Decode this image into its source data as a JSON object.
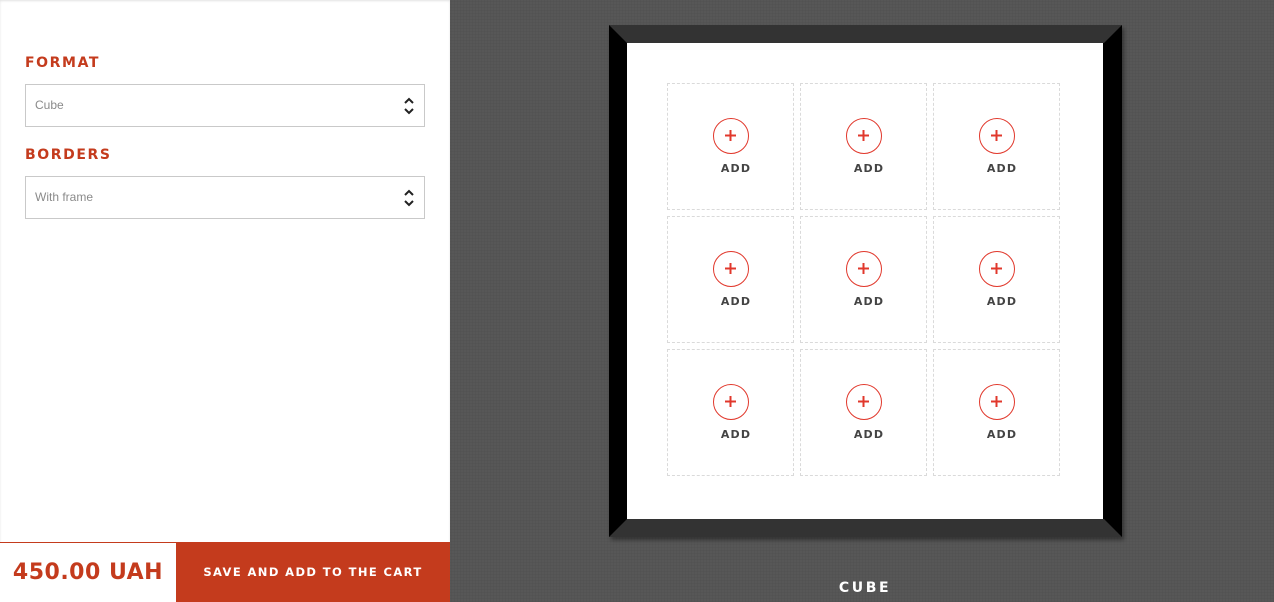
{
  "sidebar": {
    "format": {
      "label": "FORMAT",
      "selected": "Cube"
    },
    "borders": {
      "label": "BORDERS",
      "selected": "With frame"
    },
    "price": "450.00 UAH",
    "cart_button_label": "SAVE AND ADD TO THE CART"
  },
  "canvas": {
    "caption": "CUBE",
    "cells": [
      {
        "label": "ADD"
      },
      {
        "label": "ADD"
      },
      {
        "label": "ADD"
      },
      {
        "label": "ADD"
      },
      {
        "label": "ADD"
      },
      {
        "label": "ADD"
      },
      {
        "label": "ADD"
      },
      {
        "label": "ADD"
      },
      {
        "label": "ADD"
      }
    ]
  },
  "colors": {
    "accent": "#c43b1d",
    "add_icon": "#e1382c",
    "canvas_bg": "#575757",
    "frame": "#000000"
  },
  "icons": {
    "select_arrows": "chevron-up-down-icon",
    "add": "plus-circle-icon"
  }
}
